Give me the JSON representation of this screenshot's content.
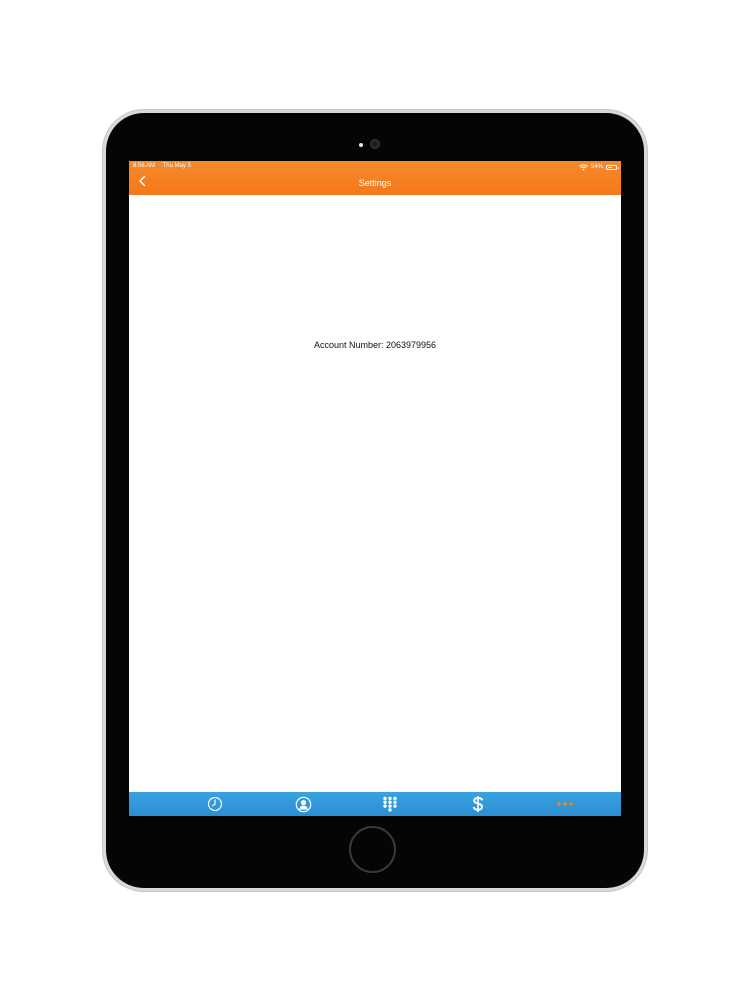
{
  "status_bar": {
    "time": "8:56 AM",
    "date": "Thu May 5",
    "battery_text": "54%",
    "battery_level": 0.54
  },
  "nav": {
    "title": "Settings",
    "back_icon": "chevron-left-icon"
  },
  "content": {
    "account_number": "Account Number: 2063979956"
  },
  "tabs": [
    {
      "id": "recents",
      "icon": "clock-icon"
    },
    {
      "id": "contacts",
      "icon": "contact-icon"
    },
    {
      "id": "keypad",
      "icon": "keypad-icon"
    },
    {
      "id": "billing",
      "icon": "dollar-icon"
    },
    {
      "id": "more",
      "icon": "more-dots-icon",
      "selected": true
    }
  ],
  "colors": {
    "top_bar": "#f5811f",
    "tab_bar": "#2f96d8",
    "tab_icon": "#ffffff",
    "tab_selected": "#f5811f"
  }
}
